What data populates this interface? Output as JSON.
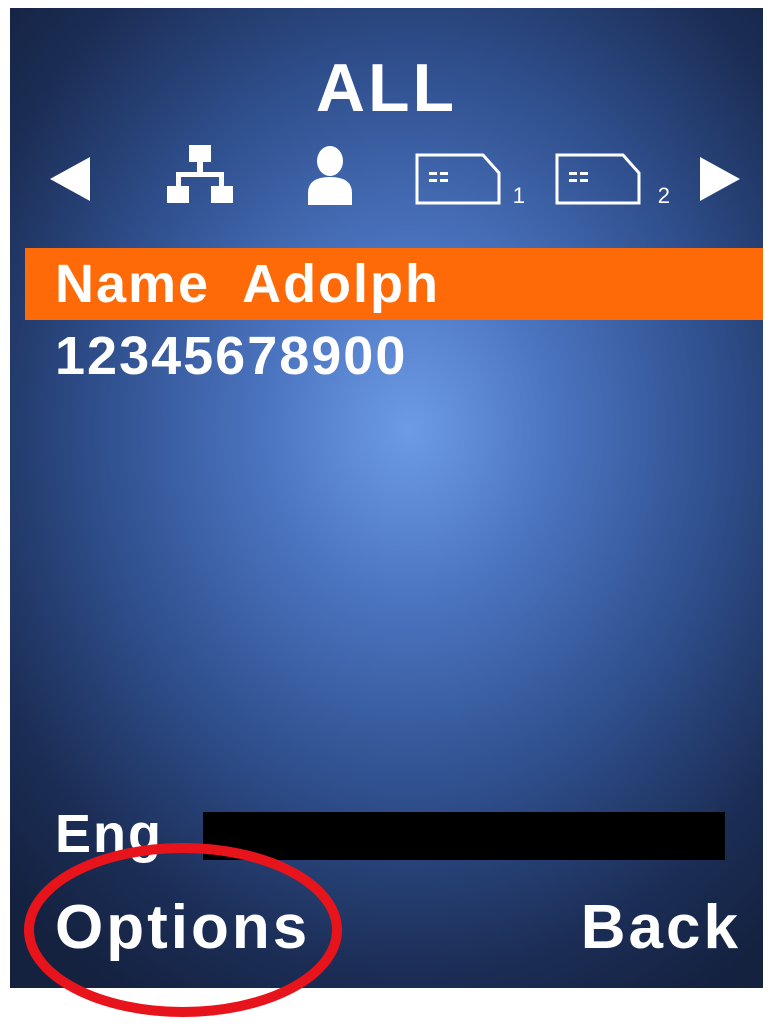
{
  "header": {
    "title": "ALL"
  },
  "tabs": {
    "prev_icon": "arrow-left-icon",
    "next_icon": "arrow-right-icon",
    "items": [
      {
        "icon": "group-hierarchy-icon",
        "sub": ""
      },
      {
        "icon": "person-icon",
        "sub": ""
      },
      {
        "icon": "sim-card-icon",
        "sub": "1"
      },
      {
        "icon": "sim-card-icon",
        "sub": "2"
      }
    ]
  },
  "contact": {
    "name": "Name  Adolph",
    "number": "12345678900"
  },
  "input": {
    "mode": "Eng",
    "value": ""
  },
  "softkeys": {
    "left": "Options",
    "right": "Back"
  },
  "colors": {
    "selection": "#ff6a08",
    "annotation": "#e8141c",
    "screen_center": "#6d9be6",
    "screen_edge": "#14213f"
  }
}
